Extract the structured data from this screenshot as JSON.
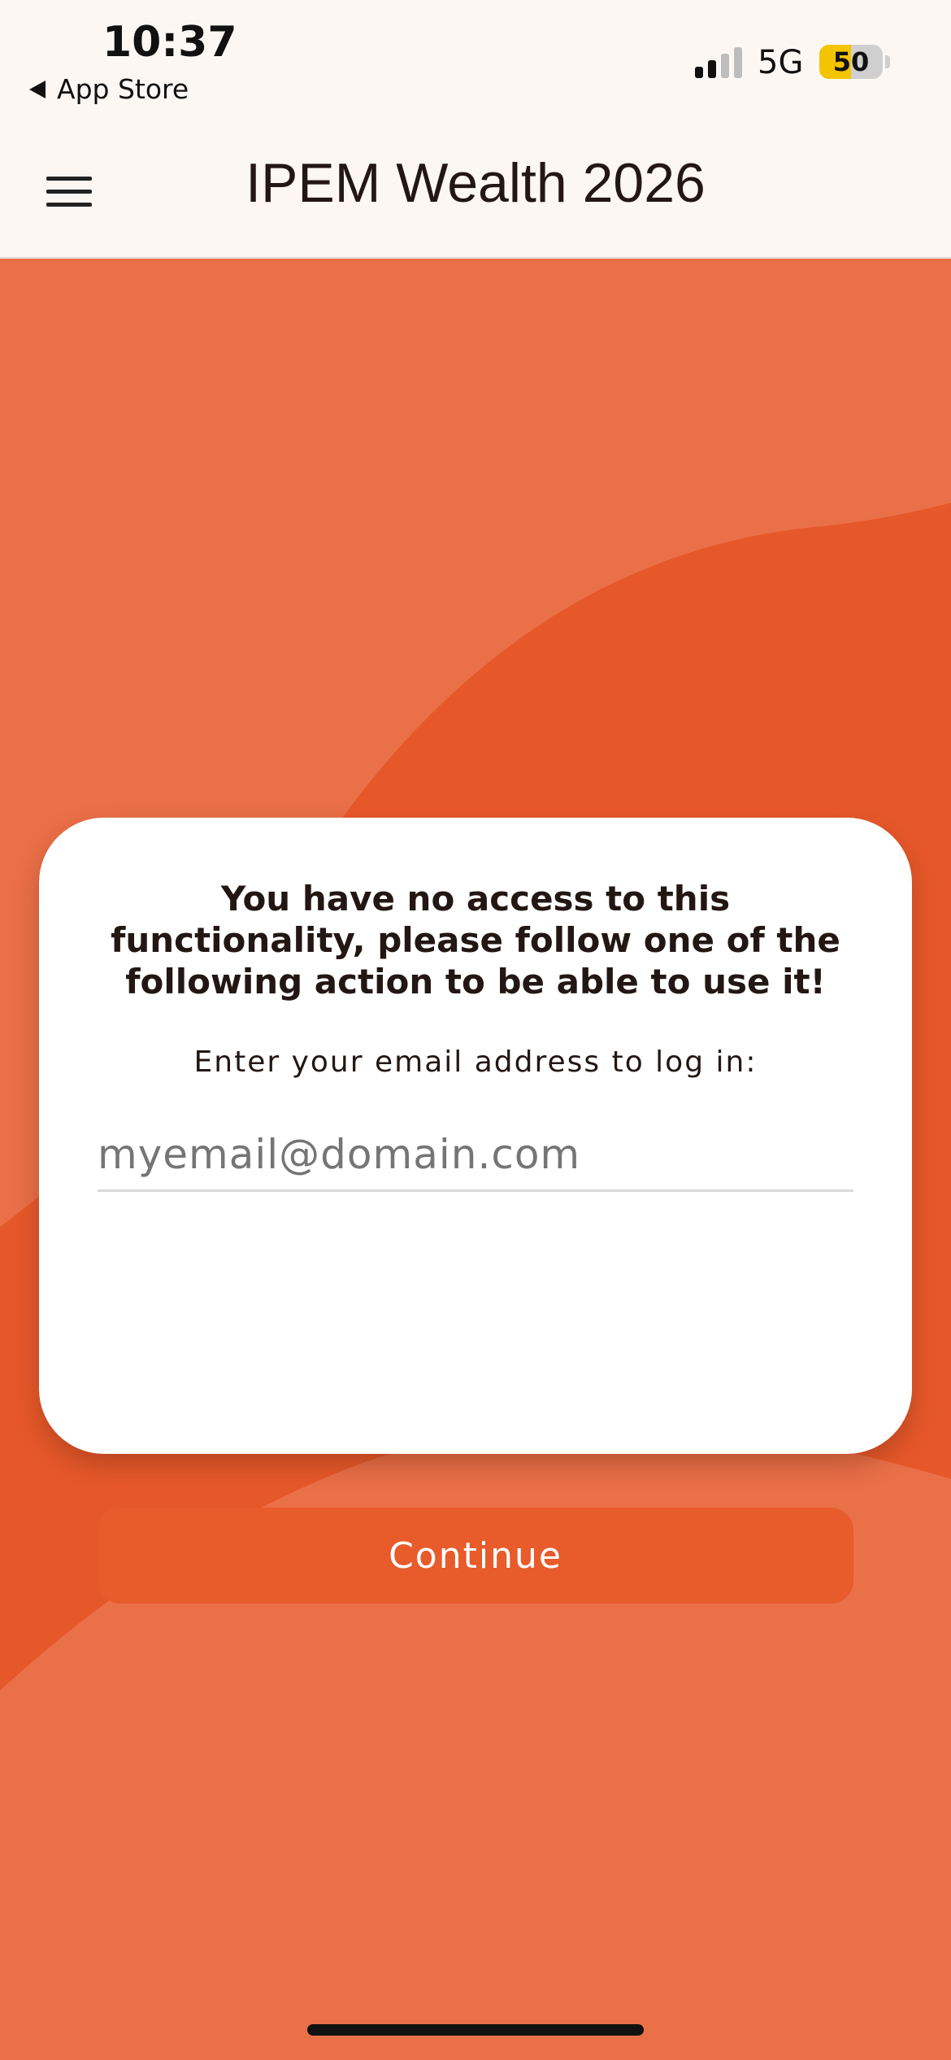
{
  "status_bar": {
    "time": "10:37",
    "back_label": "App Store",
    "network": "5G",
    "battery_level": "50",
    "battery_percent": 50
  },
  "header": {
    "title": "IPEM Wealth 2026",
    "menu_icon": "hamburger-menu-icon"
  },
  "card": {
    "message": "You have no access to this functionality, please follow one of the following action to be able to use it!",
    "prompt": "Enter your email address to log in:",
    "email_placeholder": "myemail@domain.com",
    "email_value": "",
    "continue_label": "Continue"
  },
  "colors": {
    "accent": "#e85b2b",
    "background_light": "#ea7048",
    "background_dark": "#e6582a",
    "header_bg": "#fdf7f4",
    "battery_fill": "#f5c400"
  }
}
